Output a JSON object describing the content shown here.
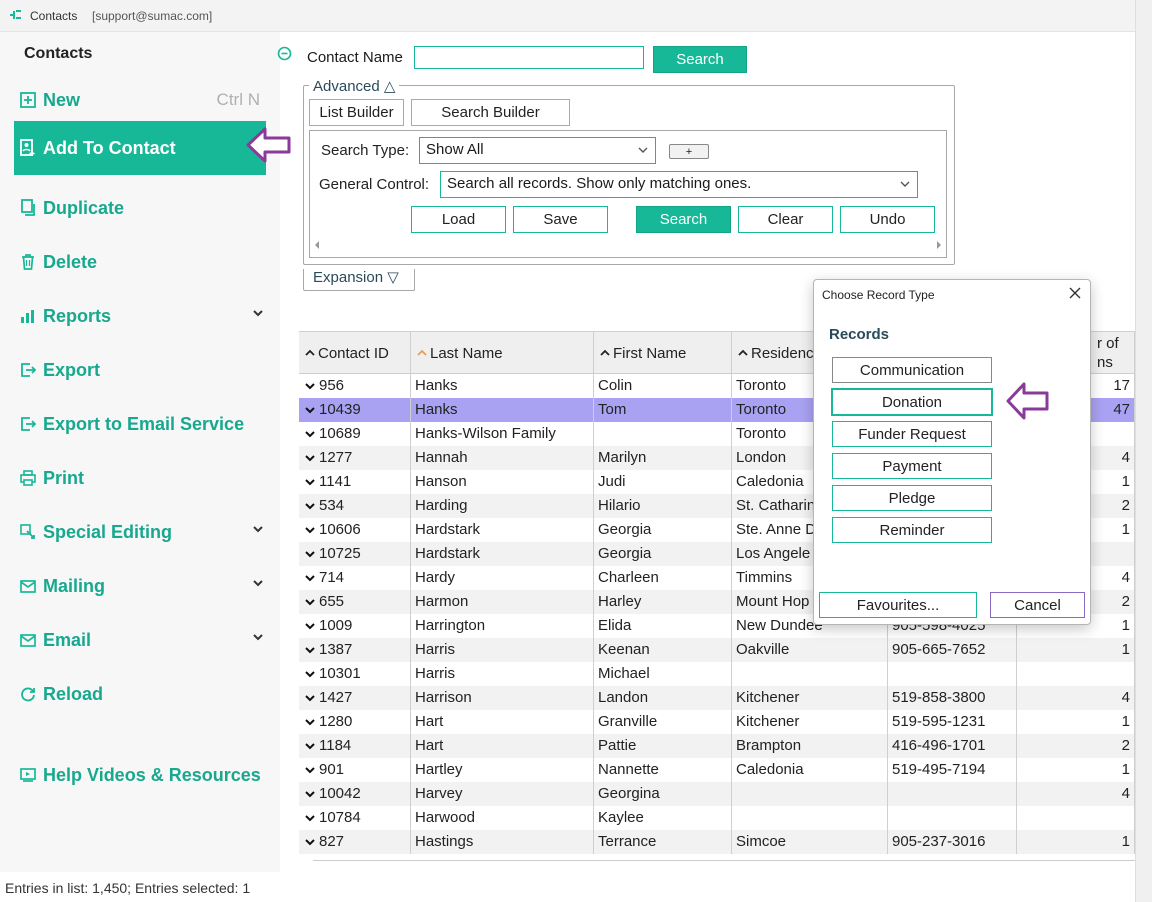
{
  "window": {
    "app_title": "Contacts",
    "user": "[support@sumac.com]"
  },
  "sidebar": {
    "title": "Contacts",
    "items": [
      {
        "label": "New",
        "icon": "plus-square-icon",
        "shortcut": "Ctrl N"
      },
      {
        "label": "Add To Contact",
        "icon": "add-to-contact-icon",
        "active": true
      },
      {
        "label": "Duplicate",
        "icon": "duplicate-icon"
      },
      {
        "label": "Delete",
        "icon": "trash-icon"
      },
      {
        "label": "Reports",
        "icon": "bar-chart-icon",
        "has_submenu": true
      },
      {
        "label": "Export",
        "icon": "export-icon"
      },
      {
        "label": "Export to Email Service",
        "icon": "export-icon"
      },
      {
        "label": "Print",
        "icon": "printer-icon"
      },
      {
        "label": "Special Editing",
        "icon": "special-editing-icon",
        "has_submenu": true
      },
      {
        "label": "Mailing",
        "icon": "mailing-icon",
        "has_submenu": true
      },
      {
        "label": "Email",
        "icon": "email-icon",
        "has_submenu": true
      },
      {
        "label": "Reload",
        "icon": "reload-icon"
      },
      {
        "label": "Help Videos & Resources",
        "icon": "video-icon"
      }
    ]
  },
  "search": {
    "contact_name_label": "Contact Name",
    "contact_name_value": "",
    "search_button": "Search"
  },
  "advanced": {
    "legend": "Advanced △",
    "list_builder": "List Builder",
    "search_builder": "Search Builder",
    "search_type_label": "Search Type:",
    "search_type_value": "Show All",
    "plus_button": "+",
    "general_control_label": "General Control:",
    "general_control_value": "Search all records. Show only matching ones.",
    "buttons": {
      "load": "Load",
      "save": "Save",
      "search": "Search",
      "clear": "Clear",
      "undo": "Undo"
    }
  },
  "expansion": {
    "label": "Expansion ▽"
  },
  "table": {
    "columns": [
      {
        "label": "Contact ID",
        "sort": "asc"
      },
      {
        "label": "Last Name",
        "sort": "asc-highlight"
      },
      {
        "label": "First Name",
        "sort": "asc"
      },
      {
        "label": "Residence",
        "sort": "asc"
      },
      {
        "label": ""
      },
      {
        "label": "r of ns"
      }
    ],
    "rows": [
      {
        "id": "956",
        "last": "Hanks",
        "first": "Colin",
        "city": "Toronto",
        "phone": "",
        "count": "17"
      },
      {
        "id": "10439",
        "last": "Hanks",
        "first": "Tom",
        "city": "Toronto",
        "phone": "",
        "count": "47",
        "selected": true
      },
      {
        "id": "10689",
        "last": "Hanks-Wilson Family",
        "first": "",
        "city": "Toronto",
        "phone": "",
        "count": ""
      },
      {
        "id": "1277",
        "last": "Hannah",
        "first": "Marilyn",
        "city": "London",
        "phone": "",
        "count": "4"
      },
      {
        "id": "1141",
        "last": "Hanson",
        "first": "Judi",
        "city": "Caledonia",
        "phone": "",
        "count": "1"
      },
      {
        "id": "534",
        "last": "Harding",
        "first": "Hilario",
        "city": "St. Catharin",
        "phone": "",
        "count": "2"
      },
      {
        "id": "10606",
        "last": "Hardstark",
        "first": "Georgia",
        "city": "Ste. Anne D",
        "phone": "",
        "count": "1"
      },
      {
        "id": "10725",
        "last": "Hardstark",
        "first": "Georgia",
        "city": "Los Angele",
        "phone": "",
        "count": ""
      },
      {
        "id": "714",
        "last": "Hardy",
        "first": "Charleen",
        "city": "Timmins",
        "phone": "",
        "count": "4"
      },
      {
        "id": "655",
        "last": "Harmon",
        "first": "Harley",
        "city": "Mount Hop",
        "phone": "",
        "count": "2"
      },
      {
        "id": "1009",
        "last": "Harrington",
        "first": "Elida",
        "city": "New Dundee",
        "phone": "905-598-4025",
        "count": "1"
      },
      {
        "id": "1387",
        "last": "Harris",
        "first": "Keenan",
        "city": "Oakville",
        "phone": "905-665-7652",
        "count": "1"
      },
      {
        "id": "10301",
        "last": "Harris",
        "first": "Michael",
        "city": "",
        "phone": "",
        "count": ""
      },
      {
        "id": "1427",
        "last": "Harrison",
        "first": "Landon",
        "city": "Kitchener",
        "phone": "519-858-3800",
        "count": "4"
      },
      {
        "id": "1280",
        "last": "Hart",
        "first": "Granville",
        "city": "Kitchener",
        "phone": "519-595-1231",
        "count": "1"
      },
      {
        "id": "1184",
        "last": "Hart",
        "first": "Pattie",
        "city": "Brampton",
        "phone": "416-496-1701",
        "count": "2"
      },
      {
        "id": "901",
        "last": "Hartley",
        "first": "Nannette",
        "city": "Caledonia",
        "phone": "519-495-7194",
        "count": "1"
      },
      {
        "id": "10042",
        "last": "Harvey",
        "first": "Georgina",
        "city": "",
        "phone": "",
        "count": "4"
      },
      {
        "id": "10784",
        "last": "Harwood",
        "first": "Kaylee",
        "city": "",
        "phone": "",
        "count": ""
      },
      {
        "id": "827",
        "last": "Hastings",
        "first": "Terrance",
        "city": "Simcoe",
        "phone": "905-237-3016",
        "count": "1"
      }
    ]
  },
  "status": {
    "text": "Entries in list: 1,450; Entries selected: 1"
  },
  "dialog": {
    "title": "Choose Record Type",
    "section": "Records",
    "record_types": [
      "Communication",
      "Donation",
      "Funder Request",
      "Payment",
      "Pledge",
      "Reminder"
    ],
    "focused": "Donation",
    "favourites": "Favourites...",
    "cancel": "Cancel"
  },
  "colors": {
    "accent": "#17b897",
    "selected_row": "#a9a2f2",
    "callout_arrow": "#8a3a9a"
  }
}
